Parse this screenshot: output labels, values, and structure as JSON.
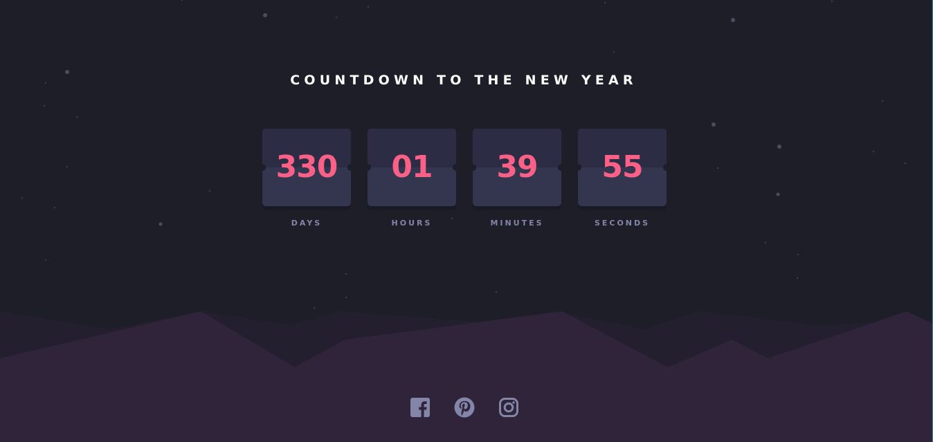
{
  "heading": "COUNTDOWN TO THE NEW YEAR",
  "countdown": {
    "days": {
      "value": "330",
      "label": "DAYS"
    },
    "hours": {
      "value": "01",
      "label": "HOURS"
    },
    "minutes": {
      "value": "39",
      "label": "MINUTES"
    },
    "seconds": {
      "value": "55",
      "label": "SECONDS"
    }
  },
  "social": [
    {
      "icon": "facebook-icon"
    },
    {
      "icon": "pinterest-icon"
    },
    {
      "icon": "instagram-icon"
    }
  ],
  "colors": {
    "background": "#1e1e29",
    "card": "#343650",
    "card_top": "#2c2c44",
    "digits": "#fb6087",
    "labels": "#8385a9",
    "hills": "#2f2439",
    "icons": "#8385a9"
  }
}
